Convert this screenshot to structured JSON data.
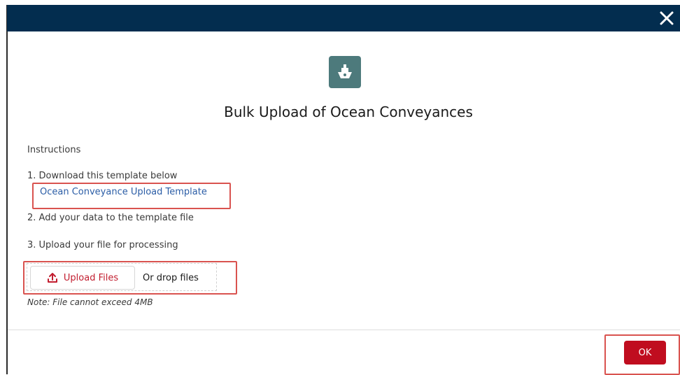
{
  "header": {
    "close_label": "Close"
  },
  "icon": {
    "name": "ship-icon",
    "color": "#4d7a7c"
  },
  "title": "Bulk Upload of Ocean Conveyances",
  "instructions": {
    "heading": "Instructions",
    "step1": "1. Download this template below",
    "template_link": "Ocean Conveyance Upload Template",
    "step2": "2. Add your data to the template file",
    "step3": "3. Upload your file for processing"
  },
  "upload": {
    "button_label": "Upload Files",
    "drop_label": "Or drop files",
    "note": "Note: File cannot exceed 4MB"
  },
  "footer": {
    "ok_label": "OK"
  },
  "colors": {
    "header_bg": "#032d4f",
    "accent": "#c00d1f",
    "link": "#2b5da6",
    "highlight": "#d9534f"
  }
}
